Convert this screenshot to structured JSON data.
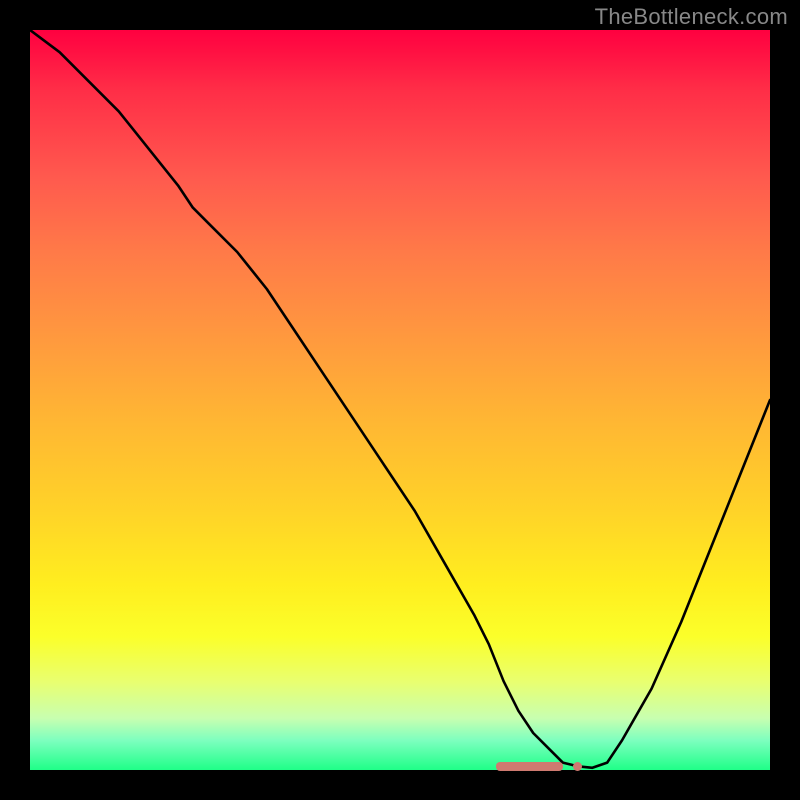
{
  "watermark": "TheBottleneck.com",
  "chart_data": {
    "type": "line",
    "title": "",
    "xlabel": "",
    "ylabel": "",
    "xlim": [
      0,
      100
    ],
    "ylim": [
      0,
      100
    ],
    "x": [
      0,
      4,
      8,
      12,
      16,
      20,
      22,
      24,
      28,
      32,
      36,
      40,
      44,
      48,
      52,
      56,
      60,
      62,
      64,
      66,
      68,
      70,
      72,
      74,
      76,
      78,
      80,
      84,
      88,
      92,
      96,
      100
    ],
    "values": [
      100,
      97,
      93,
      89,
      84,
      79,
      76,
      74,
      70,
      65,
      59,
      53,
      47,
      41,
      35,
      28,
      21,
      17,
      12,
      8,
      5,
      3,
      1,
      0.5,
      0.3,
      1,
      4,
      11,
      20,
      30,
      40,
      50
    ],
    "marker": {
      "x_start": 63,
      "x_end": 72,
      "y": 0.5,
      "trailing_dot_x": 74
    },
    "background": "rainbow-gradient",
    "axes_visible": false
  },
  "colors": {
    "curve": "#000000",
    "marker": "#cf7a70"
  }
}
